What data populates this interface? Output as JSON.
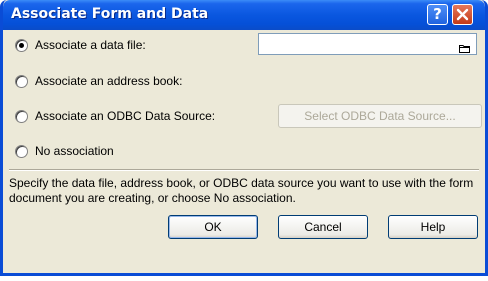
{
  "window": {
    "title": "Associate Form and Data"
  },
  "titlebar_buttons": {
    "help_glyph": "?",
    "help_icon": "help-icon",
    "close_icon": "close-icon"
  },
  "options": [
    {
      "label": "Associate a data file:",
      "selected": true
    },
    {
      "label": "Associate an address book:",
      "selected": false
    },
    {
      "label": "Associate an ODBC Data Source:",
      "selected": false
    },
    {
      "label": "No association",
      "selected": false
    }
  ],
  "file_field": {
    "value": "",
    "browse_icon": "folder-icon"
  },
  "odbc_button": {
    "label": "Select ODBC Data Source...",
    "enabled": false
  },
  "description": "Specify the data file, address book, or ODBC data source you want to use with the form document you are creating, or choose No association.",
  "buttons": {
    "ok": "OK",
    "cancel": "Cancel",
    "help": "Help"
  },
  "colors": {
    "titlebar": "#0A57E0",
    "dialog_face": "#ECE9D8",
    "close_button": "#C33A18",
    "disabled_text": "#ACA899"
  }
}
